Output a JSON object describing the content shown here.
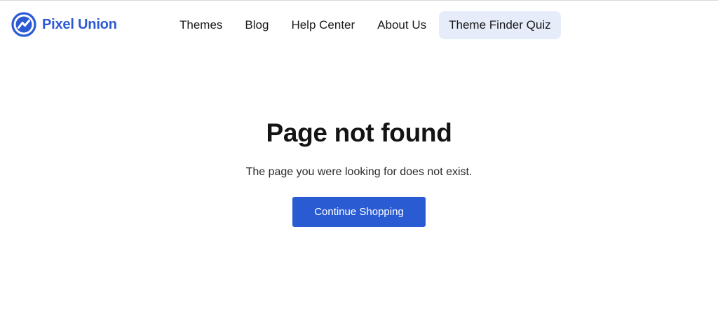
{
  "brand": {
    "name": "Pixel Union",
    "color": "#2b5ad4",
    "logo_icon": "pixel-union-logo-icon"
  },
  "nav": {
    "items": [
      {
        "label": "Themes"
      },
      {
        "label": "Blog"
      },
      {
        "label": "Help Center"
      },
      {
        "label": "About Us"
      },
      {
        "label": "Theme Finder Quiz",
        "highlighted": true
      }
    ],
    "highlight_bg": "#e6ecfa"
  },
  "main": {
    "title": "Page not found",
    "message": "The page you were looking for does not exist.",
    "button_label": "Continue Shopping",
    "button_color": "#2a5bd3"
  }
}
